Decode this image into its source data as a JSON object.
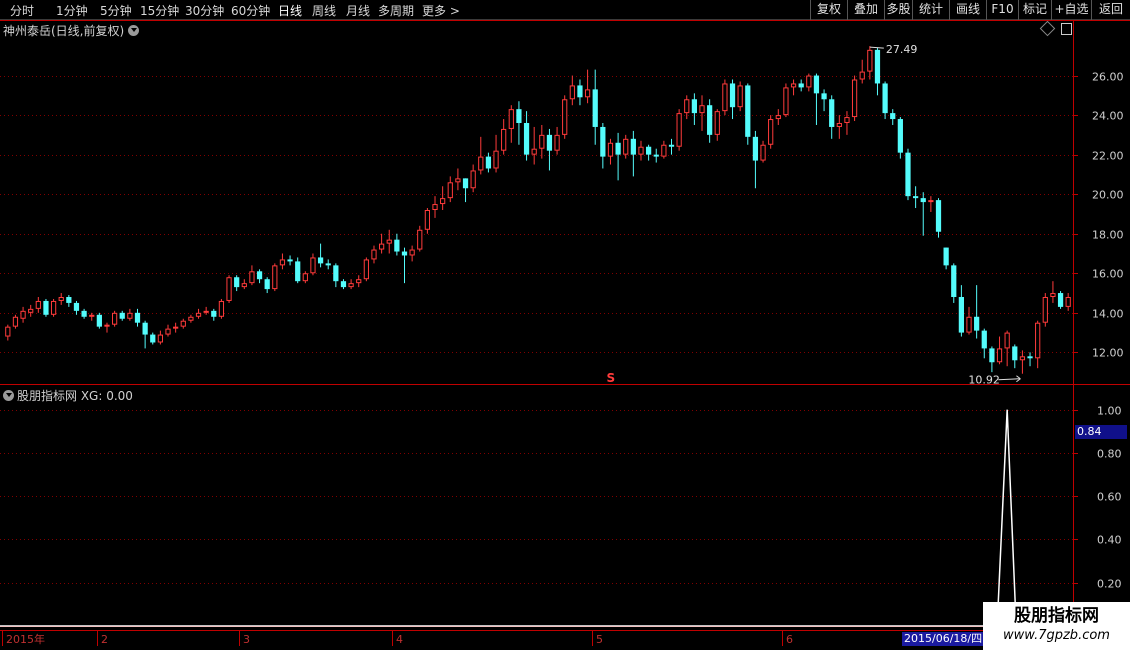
{
  "toolbar": {
    "periods": [
      "分时",
      "1分钟",
      "5分钟",
      "15分钟",
      "30分钟",
      "60分钟",
      "日线",
      "周线",
      "月线",
      "多周期",
      "更多 >"
    ],
    "active_period": "日线",
    "right_buttons": [
      "复权",
      "叠加",
      "多股",
      "统计",
      "画线",
      "F10",
      "标记",
      "+自选",
      "返回"
    ]
  },
  "main_panel": {
    "title": "神州泰岳(日线,前复权)",
    "price_ticks": [
      "26.00",
      "24.00",
      "22.00",
      "20.00",
      "18.00",
      "16.00",
      "14.00",
      "12.00"
    ],
    "high_label": "27.49",
    "low_label": "10.92",
    "signal_marker": "S"
  },
  "indicator_panel": {
    "title": "股朋指标网 XG: 0.00",
    "ticks": [
      "1.00",
      "0.80",
      "0.60",
      "0.40",
      "0.20"
    ],
    "current_value": "0.84"
  },
  "date_axis": {
    "labels": [
      "2015年",
      "2",
      "3",
      "4",
      "5",
      "6"
    ],
    "cursor_date": "2015/06/18/四"
  },
  "watermark": {
    "line1": "股朋指标网",
    "line2": "www.7gpzb.com"
  },
  "colors": {
    "up": "#ff3b3b",
    "down": "#54fcfc",
    "grid": "#800000",
    "axis": "#c00000",
    "xg_line": "#ffffff"
  },
  "chart_data": {
    "type": "candlestick",
    "price_range": [
      10.4,
      28.0
    ],
    "indicator_range": [
      0,
      1.1
    ],
    "candles": [
      [
        12.8,
        13.3,
        12.6,
        13.4
      ],
      [
        13.3,
        13.8,
        13.2,
        13.9
      ],
      [
        13.7,
        14.1,
        13.5,
        14.3
      ],
      [
        14.0,
        14.2,
        13.8,
        14.4
      ],
      [
        14.2,
        14.6,
        14.0,
        14.8
      ],
      [
        14.6,
        13.9,
        13.8,
        14.7
      ],
      [
        13.9,
        14.6,
        13.8,
        14.7
      ],
      [
        14.6,
        14.8,
        14.4,
        15.0
      ],
      [
        14.8,
        14.5,
        14.3,
        14.9
      ],
      [
        14.5,
        14.1,
        13.9,
        14.6
      ],
      [
        14.1,
        13.8,
        13.7,
        14.2
      ],
      [
        13.8,
        13.9,
        13.6,
        14.0
      ],
      [
        13.9,
        13.3,
        13.2,
        14.0
      ],
      [
        13.3,
        13.4,
        13.0,
        13.5
      ],
      [
        13.4,
        14.0,
        13.3,
        14.1
      ],
      [
        14.0,
        13.7,
        13.6,
        14.1
      ],
      [
        13.7,
        14.0,
        13.6,
        14.2
      ],
      [
        14.0,
        13.5,
        13.3,
        14.2
      ],
      [
        13.5,
        12.9,
        12.2,
        13.6
      ],
      [
        12.9,
        12.5,
        12.4,
        13.0
      ],
      [
        12.5,
        12.9,
        12.4,
        13.1
      ],
      [
        12.9,
        13.2,
        12.8,
        13.4
      ],
      [
        13.2,
        13.3,
        13.0,
        13.5
      ],
      [
        13.3,
        13.6,
        13.2,
        13.7
      ],
      [
        13.6,
        13.8,
        13.5,
        13.9
      ],
      [
        13.8,
        14.0,
        13.7,
        14.2
      ],
      [
        14.0,
        14.1,
        13.9,
        14.3
      ],
      [
        14.1,
        13.8,
        13.6,
        14.2
      ],
      [
        13.8,
        14.6,
        13.7,
        14.7
      ],
      [
        14.6,
        15.8,
        14.5,
        15.9
      ],
      [
        15.8,
        15.3,
        15.1,
        15.9
      ],
      [
        15.3,
        15.5,
        15.2,
        15.7
      ],
      [
        15.5,
        16.1,
        15.4,
        16.4
      ],
      [
        16.1,
        15.7,
        15.5,
        16.2
      ],
      [
        15.7,
        15.2,
        15.0,
        15.8
      ],
      [
        15.2,
        16.4,
        15.1,
        16.5
      ],
      [
        16.4,
        16.7,
        16.2,
        17.0
      ],
      [
        16.7,
        16.6,
        16.4,
        16.9
      ],
      [
        16.6,
        15.6,
        15.5,
        16.8
      ],
      [
        15.6,
        16.0,
        15.5,
        16.1
      ],
      [
        16.0,
        16.8,
        15.9,
        17.0
      ],
      [
        16.8,
        16.5,
        16.3,
        17.5
      ],
      [
        16.5,
        16.4,
        16.2,
        16.7
      ],
      [
        16.4,
        15.6,
        15.3,
        16.5
      ],
      [
        15.6,
        15.3,
        15.2,
        15.7
      ],
      [
        15.3,
        15.5,
        15.2,
        15.7
      ],
      [
        15.5,
        15.7,
        15.3,
        15.9
      ],
      [
        15.7,
        16.7,
        15.6,
        16.8
      ],
      [
        16.7,
        17.2,
        16.5,
        17.4
      ],
      [
        17.2,
        17.5,
        17.0,
        18.0
      ],
      [
        17.5,
        17.7,
        17.0,
        18.2
      ],
      [
        17.7,
        17.1,
        16.9,
        18.0
      ],
      [
        17.1,
        16.9,
        15.5,
        17.3
      ],
      [
        16.9,
        17.2,
        16.6,
        17.4
      ],
      [
        17.2,
        18.2,
        17.1,
        18.4
      ],
      [
        18.2,
        19.2,
        18.0,
        19.3
      ],
      [
        19.2,
        19.5,
        18.8,
        19.9
      ],
      [
        19.5,
        19.8,
        19.2,
        20.4
      ],
      [
        19.8,
        20.6,
        19.6,
        20.9
      ],
      [
        20.6,
        20.8,
        20.2,
        21.3
      ],
      [
        20.8,
        20.3,
        19.6,
        20.8
      ],
      [
        20.3,
        21.2,
        20.1,
        21.5
      ],
      [
        21.2,
        21.9,
        21.0,
        22.9
      ],
      [
        21.9,
        21.3,
        21.1,
        22.1
      ],
      [
        21.3,
        22.2,
        21.1,
        23.0
      ],
      [
        22.2,
        23.3,
        22.0,
        23.8
      ],
      [
        23.3,
        24.3,
        22.6,
        24.5
      ],
      [
        24.3,
        23.6,
        22.5,
        24.7
      ],
      [
        23.6,
        22.0,
        21.7,
        24.2
      ],
      [
        22.0,
        22.3,
        21.5,
        23.4
      ],
      [
        22.3,
        23.0,
        21.8,
        23.5
      ],
      [
        23.0,
        22.2,
        21.2,
        23.3
      ],
      [
        22.2,
        23.0,
        22.0,
        23.4
      ],
      [
        23.0,
        24.8,
        22.8,
        25.0
      ],
      [
        24.8,
        25.5,
        24.5,
        26.0
      ],
      [
        25.5,
        24.9,
        24.5,
        25.8
      ],
      [
        24.9,
        25.3,
        24.6,
        26.3
      ],
      [
        25.3,
        23.4,
        22.5,
        26.3
      ],
      [
        23.4,
        21.9,
        21.3,
        23.6
      ],
      [
        21.9,
        22.6,
        21.5,
        22.8
      ],
      [
        22.6,
        22.0,
        20.7,
        23.1
      ],
      [
        22.0,
        22.8,
        21.8,
        23.0
      ],
      [
        22.8,
        22.0,
        20.9,
        23.2
      ],
      [
        22.0,
        22.4,
        21.7,
        22.7
      ],
      [
        22.4,
        22.0,
        21.7,
        22.5
      ],
      [
        22.0,
        21.9,
        21.6,
        22.3
      ],
      [
        21.9,
        22.5,
        21.8,
        22.7
      ],
      [
        22.5,
        22.4,
        22.0,
        22.8
      ],
      [
        22.4,
        24.1,
        22.2,
        24.3
      ],
      [
        24.1,
        24.8,
        23.8,
        25.0
      ],
      [
        24.8,
        24.1,
        23.5,
        25.1
      ],
      [
        24.1,
        24.5,
        23.2,
        25.0
      ],
      [
        24.5,
        23.0,
        22.6,
        24.8
      ],
      [
        23.0,
        24.2,
        22.7,
        24.3
      ],
      [
        24.2,
        25.6,
        24.0,
        25.8
      ],
      [
        25.6,
        24.4,
        23.8,
        25.8
      ],
      [
        24.4,
        25.5,
        24.2,
        25.7
      ],
      [
        25.5,
        22.9,
        22.5,
        25.6
      ],
      [
        22.9,
        21.7,
        20.3,
        23.2
      ],
      [
        21.7,
        22.5,
        21.6,
        22.7
      ],
      [
        22.5,
        23.8,
        22.3,
        24.0
      ],
      [
        23.8,
        24.0,
        23.5,
        24.3
      ],
      [
        24.0,
        25.4,
        23.9,
        25.6
      ],
      [
        25.4,
        25.6,
        25.0,
        25.8
      ],
      [
        25.6,
        25.4,
        25.2,
        25.8
      ],
      [
        25.4,
        26.0,
        25.2,
        26.1
      ],
      [
        26.0,
        25.1,
        23.5,
        26.1
      ],
      [
        25.1,
        24.8,
        24.2,
        25.3
      ],
      [
        24.8,
        23.4,
        22.8,
        25.0
      ],
      [
        23.4,
        23.6,
        22.8,
        24.0
      ],
      [
        23.6,
        23.9,
        23.0,
        24.2
      ],
      [
        23.9,
        25.8,
        23.7,
        26.0
      ],
      [
        25.8,
        26.2,
        25.6,
        26.8
      ],
      [
        26.2,
        27.3,
        25.8,
        27.49
      ],
      [
        27.3,
        25.6,
        25.0,
        27.4
      ],
      [
        25.6,
        24.1,
        23.8,
        25.7
      ],
      [
        24.1,
        23.8,
        23.5,
        24.3
      ],
      [
        23.8,
        22.1,
        21.8,
        23.9
      ],
      [
        22.1,
        19.9,
        19.7,
        22.3
      ],
      [
        19.9,
        19.8,
        19.3,
        20.4
      ],
      [
        19.8,
        19.6,
        17.9,
        20.1
      ],
      [
        19.6,
        19.7,
        19.1,
        19.9
      ],
      [
        19.7,
        18.1,
        17.8,
        19.8
      ],
      [
        17.3,
        16.4,
        16.2,
        17.3
      ],
      [
        16.4,
        14.8,
        14.5,
        16.5
      ],
      [
        14.8,
        13.0,
        12.8,
        15.4
      ],
      [
        13.0,
        13.8,
        12.9,
        14.3
      ],
      [
        13.8,
        13.1,
        12.7,
        15.4
      ],
      [
        13.1,
        12.2,
        11.7,
        13.2
      ],
      [
        12.2,
        11.5,
        11.0,
        12.3
      ],
      [
        11.5,
        12.2,
        11.4,
        12.8
      ],
      [
        12.2,
        13.0,
        11.3,
        13.1
      ],
      [
        12.3,
        11.6,
        11.2,
        12.4
      ],
      [
        11.6,
        11.8,
        10.92,
        12.1
      ],
      [
        11.8,
        11.7,
        11.3,
        12.0
      ],
      [
        11.7,
        13.5,
        11.2,
        13.6
      ],
      [
        13.5,
        14.8,
        13.3,
        15.0
      ],
      [
        14.8,
        15.0,
        14.5,
        15.6
      ],
      [
        15.0,
        14.3,
        14.2,
        15.1
      ],
      [
        14.3,
        14.8,
        14.1,
        15.0
      ]
    ],
    "xg_values_tail": [
      0,
      0,
      1.0,
      0
    ]
  }
}
